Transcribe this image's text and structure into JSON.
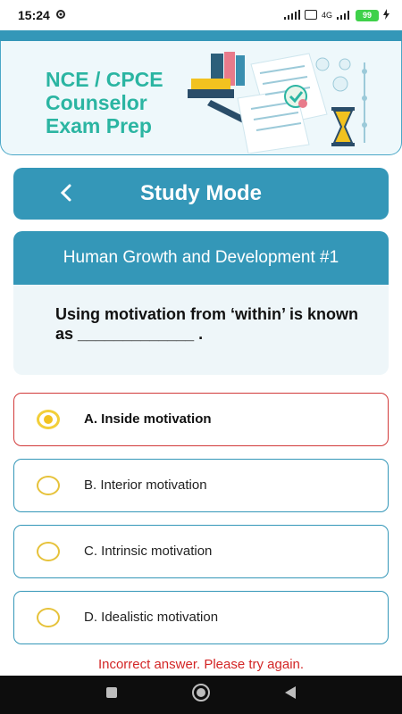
{
  "status": {
    "time": "15:24",
    "network": "4G",
    "battery": "99"
  },
  "banner": {
    "title": "NCE / CPCE\nCounselor\nExam Prep"
  },
  "header": {
    "title": "Study Mode",
    "back_icon": "chevron-left-icon"
  },
  "question": {
    "category": "Human Growth and Development #1",
    "text": "Using motivation from ‘within’ is known as _____________ ."
  },
  "options": [
    {
      "label": "A. Inside motivation",
      "selected": true,
      "state": "incorrect"
    },
    {
      "label": "B. Interior motivation",
      "selected": false
    },
    {
      "label": "C. Intrinsic motivation",
      "selected": false
    },
    {
      "label": "D. Idealistic motivation",
      "selected": false
    }
  ],
  "feedback": "Incorrect answer. Please try again.",
  "colors": {
    "accent": "#3497b8",
    "banner_text": "#2bb5a2",
    "error": "#d32626",
    "radio": "#f2c21f"
  }
}
